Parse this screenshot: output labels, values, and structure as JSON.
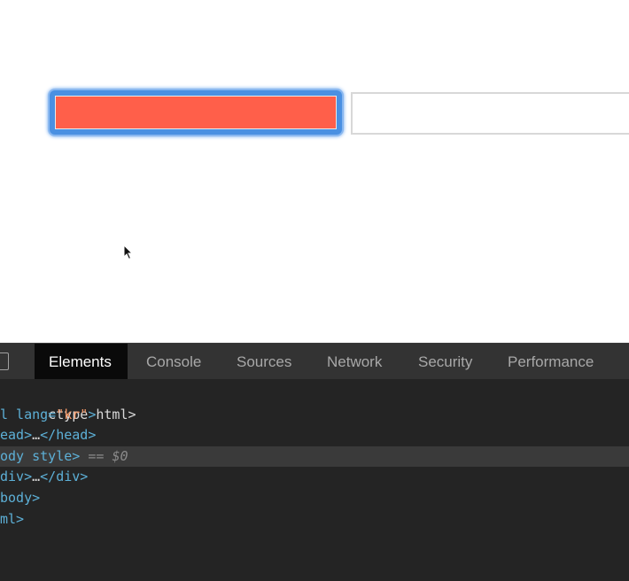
{
  "page": {
    "input_focused_state": "focused",
    "input_focused_fill": "#ff5f4a",
    "focus_ring_color": "#4a90e2",
    "cursor_icon": "arrow-cursor-icon"
  },
  "devtools": {
    "tabs": [
      {
        "label": "Elements",
        "active": true
      },
      {
        "label": "Console",
        "active": false
      },
      {
        "label": "Sources",
        "active": false
      },
      {
        "label": "Network",
        "active": false
      },
      {
        "label": "Security",
        "active": false
      },
      {
        "label": "Performance",
        "active": false
      }
    ],
    "code": {
      "l1": "ctype html>",
      "l2_tag": "l lang=",
      "l2_str": "\"kr\"",
      "l2_end": ">",
      "l3_a": "ead>",
      "l3_ell": "…",
      "l3_b": "</head>",
      "l4_tag": "ody style>",
      "l4_eq": " == ",
      "l4_dollar": "$0",
      "l5_a": "div>",
      "l5_ell": "…",
      "l5_b": "</div>",
      "l6": "body>",
      "l7": "ml>"
    }
  }
}
